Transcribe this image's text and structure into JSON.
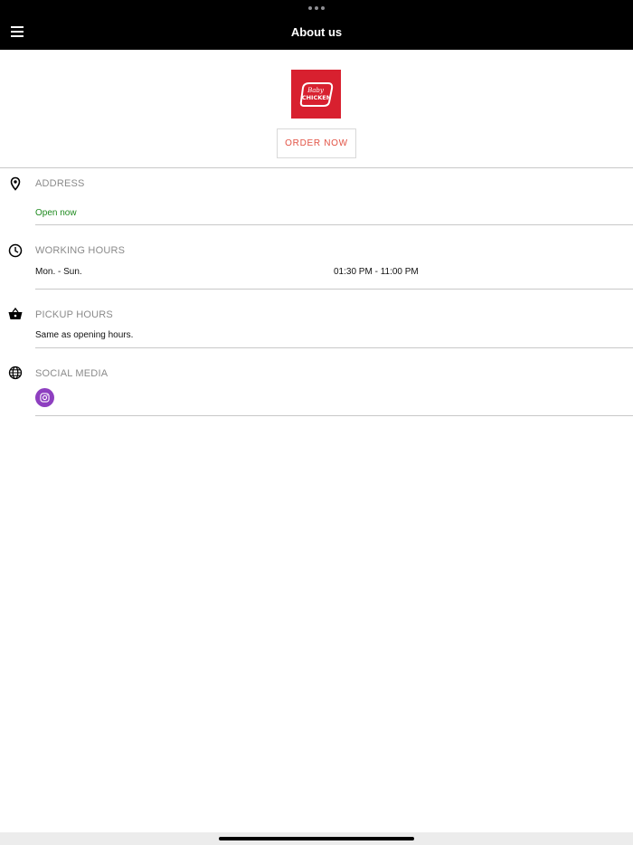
{
  "header": {
    "title": "About us"
  },
  "logo": {
    "line1": "Baby",
    "line2": "CHICKEN",
    "color": "#d8202f"
  },
  "order_button": {
    "label": "ORDER NOW",
    "color": "#e25244"
  },
  "sections": {
    "address": {
      "title": "ADDRESS",
      "status": "Open now",
      "status_color": "#1e8a1e",
      "icon": "location-pin-icon"
    },
    "working_hours": {
      "title": "WORKING HOURS",
      "day": "Mon. - Sun.",
      "hours": "01:30 PM - 11:00 PM",
      "icon": "clock-icon"
    },
    "pickup_hours": {
      "title": "PICKUP HOURS",
      "text": "Same as opening hours.",
      "icon": "basket-icon"
    },
    "social_media": {
      "title": "SOCIAL MEDIA",
      "icon": "globe-icon",
      "links": [
        {
          "name": "instagram-icon",
          "color": "#8e3fc0"
        }
      ]
    }
  }
}
